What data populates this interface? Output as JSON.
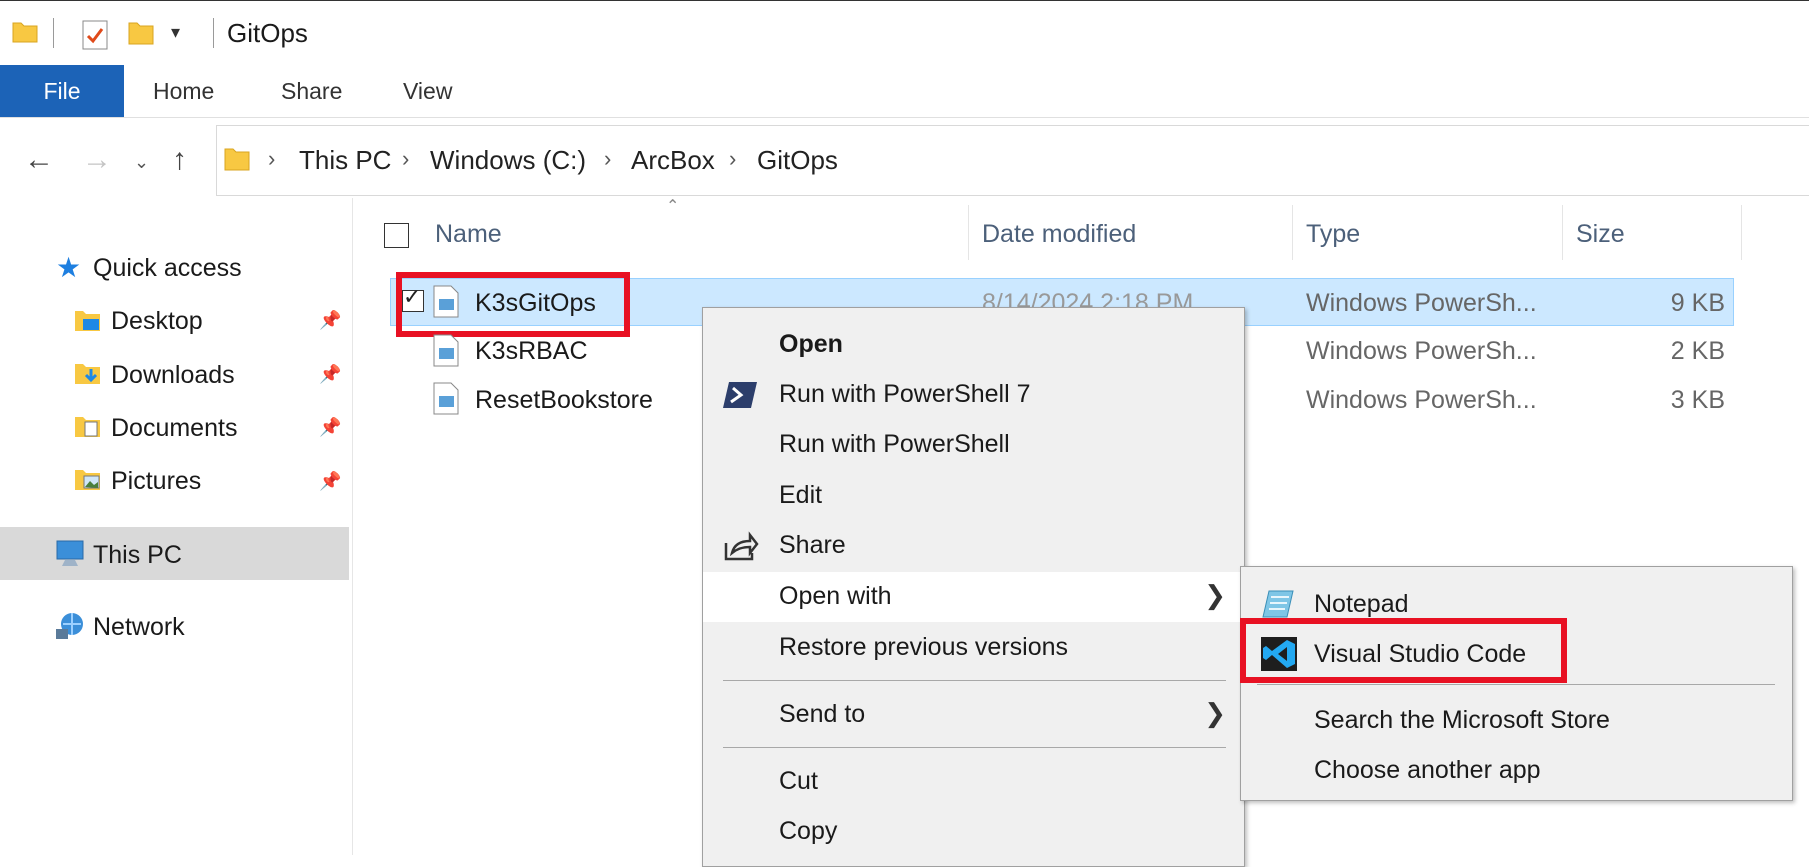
{
  "window": {
    "title": "GitOps"
  },
  "ribbon": {
    "tabs": [
      "File",
      "Home",
      "Share",
      "View"
    ]
  },
  "address": {
    "crumbs": [
      "This PC",
      "Windows (C:)",
      "ArcBox",
      "GitOps"
    ]
  },
  "nav": {
    "quick_access": "Quick access",
    "pinned": [
      "Desktop",
      "Downloads",
      "Documents",
      "Pictures"
    ],
    "this_pc": "This PC",
    "network": "Network"
  },
  "columns": {
    "name": "Name",
    "date": "Date modified",
    "type": "Type",
    "size": "Size"
  },
  "files": [
    {
      "name": "K3sGitOps",
      "date": "8/14/2024 2:18 PM",
      "type": "Windows PowerSh...",
      "size": "9 KB",
      "selected": true
    },
    {
      "name": "K3sRBAC",
      "date": "",
      "type": "Windows PowerSh...",
      "size": "2 KB",
      "selected": false
    },
    {
      "name": "ResetBookstore",
      "date": "",
      "type": "Windows PowerSh...",
      "size": "3 KB",
      "selected": false
    }
  ],
  "context_menu": {
    "open": "Open",
    "run_ps7": "Run with PowerShell 7",
    "run_ps": "Run with PowerShell",
    "edit": "Edit",
    "share": "Share",
    "open_with": "Open with",
    "restore": "Restore previous versions",
    "send_to": "Send to",
    "cut": "Cut",
    "copy": "Copy"
  },
  "open_with_menu": {
    "notepad": "Notepad",
    "vscode": "Visual Studio Code",
    "store": "Search the Microsoft Store",
    "choose": "Choose another app"
  },
  "colors": {
    "file_tab": "#1c63b7",
    "selection": "#cce8ff",
    "highlight_box": "#e81123",
    "folder": "#f8c842"
  }
}
